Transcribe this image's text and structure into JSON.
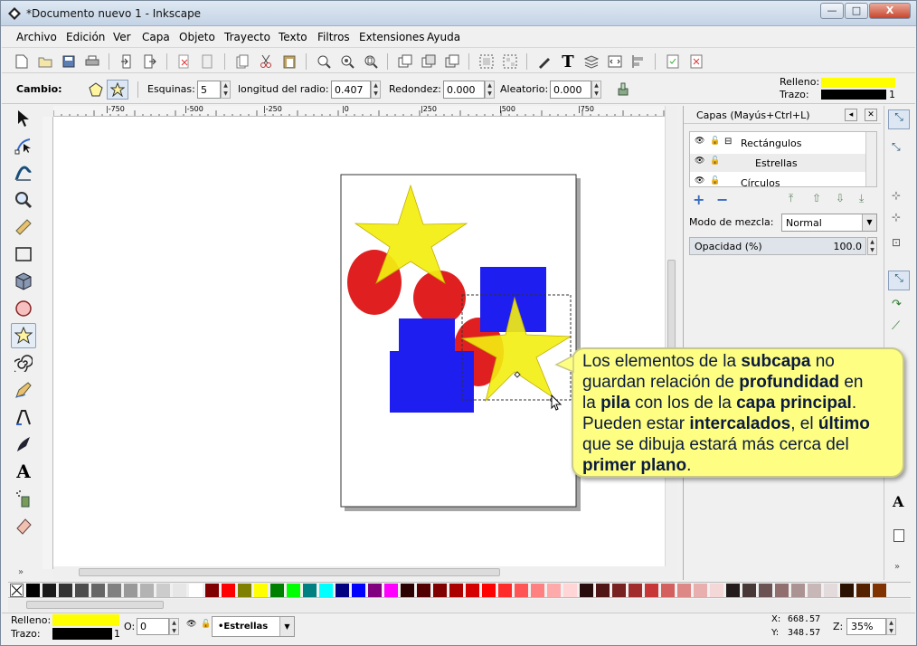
{
  "window": {
    "title": "*Documento nuevo 1 - Inkscape",
    "min_label": "—",
    "max_label": "□",
    "close_label": "X"
  },
  "menu": [
    "Archivo",
    "Edición",
    "Ver",
    "Capa",
    "Objeto",
    "Trayecto",
    "Texto",
    "Filtros",
    "Extensiones",
    "Ayuda"
  ],
  "tool_controls": {
    "cambio_label": "Cambio:",
    "corners_label": "Esquinas:",
    "corners_value": "5",
    "radius_label": "longitud del radio:",
    "radius_value": "0.407",
    "rounding_label": "Redondez:",
    "rounding_value": "0.000",
    "random_label": "Aleatorio:",
    "random_value": "0.000"
  },
  "style_indicator_top": {
    "fill_label": "Relleno:",
    "stroke_label": "Trazo:",
    "stroke_width": "1",
    "fill_color": "#ffff00",
    "stroke_color": "#000000"
  },
  "ruler": {
    "ticks": [
      "|-750",
      "|-500",
      "|-250",
      "|0",
      "|250",
      "|500",
      "|750"
    ]
  },
  "layers_panel": {
    "title": "Capas (Mayús+Ctrl+L)",
    "layers": [
      {
        "name": "Rectángulos",
        "sub": false
      },
      {
        "name": "Estrellas",
        "sub": true
      },
      {
        "name": "Círculos",
        "sub": false
      }
    ],
    "blend_label": "Modo de mezcla:",
    "blend_value": "Normal",
    "opacity_label": "Opacidad (%)",
    "opacity_value": "100.0"
  },
  "callout": {
    "lines": [
      [
        {
          "t": "Los elementos de la ",
          "b": false
        },
        {
          "t": "subcapa",
          "b": true
        },
        {
          "t": " no",
          "b": false
        }
      ],
      [
        {
          "t": "guardan relación de ",
          "b": false
        },
        {
          "t": "profundidad",
          "b": true
        },
        {
          "t": " en",
          "b": false
        }
      ],
      [
        {
          "t": "la ",
          "b": false
        },
        {
          "t": "pila",
          "b": true
        },
        {
          "t": " con los de la ",
          "b": false
        },
        {
          "t": "capa principal",
          "b": true
        },
        {
          "t": ".",
          "b": false
        }
      ],
      [
        {
          "t": "Pueden estar ",
          "b": false
        },
        {
          "t": "intercalados",
          "b": true
        },
        {
          "t": ", el ",
          "b": false
        },
        {
          "t": "último",
          "b": true
        }
      ],
      [
        {
          "t": "que se dibuja estará más cerca del",
          "b": false
        }
      ],
      [
        {
          "t": "primer plano",
          "b": true
        },
        {
          "t": ".",
          "b": false
        }
      ]
    ]
  },
  "palette_colors": [
    "#000000",
    "#1a1a1a",
    "#333333",
    "#4d4d4d",
    "#666666",
    "#808080",
    "#999999",
    "#b3b3b3",
    "#cccccc",
    "#e6e6e6",
    "#ffffff",
    "#800000",
    "#ff0000",
    "#808000",
    "#ffff00",
    "#008000",
    "#00ff00",
    "#008080",
    "#00ffff",
    "#000080",
    "#0000ff",
    "#800080",
    "#ff00ff",
    "#2b0000",
    "#550000",
    "#800000",
    "#aa0000",
    "#d40000",
    "#ff0000",
    "#ff2a2a",
    "#ff5555",
    "#ff8080",
    "#ffaaaa",
    "#ffd5d5",
    "#280b0b",
    "#501616",
    "#782121",
    "#a02c2c",
    "#c83737",
    "#d35f5f",
    "#de8787",
    "#e9afaf",
    "#f4d7d7",
    "#241c1c",
    "#483737",
    "#6c5353",
    "#916f6f",
    "#ac9393",
    "#c8b7b7",
    "#e3dbdb",
    "#2b1100",
    "#552200",
    "#803300"
  ],
  "status": {
    "fill_label": "Relleno:",
    "stroke_label": "Trazo:",
    "stroke_width": "1",
    "opacity_label": "O:",
    "opacity_value": "0",
    "layer_value": "•Estrellas",
    "x_label": "X:",
    "x_value": "668.57",
    "y_label": "Y:",
    "y_value": "348.57",
    "zoom_label": "Z:",
    "zoom_value": "35%"
  }
}
